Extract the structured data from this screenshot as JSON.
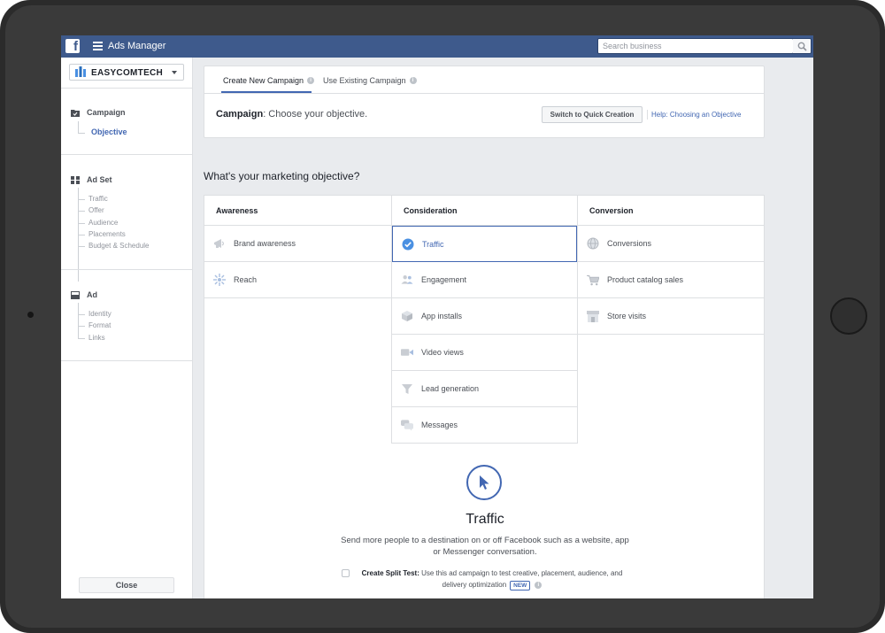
{
  "topbar": {
    "logo_letter": "f",
    "app_title": "Ads Manager",
    "search_placeholder": "Search business"
  },
  "sidebar": {
    "account_name": "EASYCOMTECH",
    "campaign": {
      "title": "Campaign",
      "active_item": "Objective"
    },
    "adset": {
      "title": "Ad Set",
      "items": [
        "Traffic",
        "Offer",
        "Audience",
        "Placements",
        "Budget & Schedule"
      ]
    },
    "ad": {
      "title": "Ad",
      "items": [
        "Identity",
        "Format",
        "Links"
      ]
    },
    "close_label": "Close"
  },
  "tabs": {
    "create_new": "Create New Campaign",
    "use_existing": "Use Existing Campaign",
    "info_glyph": "i"
  },
  "campaign_header": {
    "label": "Campaign",
    "text": ": Choose your objective.",
    "quick_button": "Switch to Quick Creation",
    "help_link": "Help: Choosing an Objective"
  },
  "question": "What's your marketing objective?",
  "objectives": {
    "awareness": {
      "title": "Awareness",
      "items": [
        "Brand awareness",
        "Reach"
      ]
    },
    "consideration": {
      "title": "Consideration",
      "items": [
        "Traffic",
        "Engagement",
        "App installs",
        "Video views",
        "Lead generation",
        "Messages"
      ]
    },
    "conversion": {
      "title": "Conversion",
      "items": [
        "Conversions",
        "Product catalog sales",
        "Store visits"
      ]
    }
  },
  "detail": {
    "title": "Traffic",
    "description": "Send more people to a destination on or off Facebook such as a website, app or Messenger conversation.",
    "split_label": "Create Split Test:",
    "split_text": " Use this ad campaign to test creative, placement, audience, and delivery optimization",
    "new_badge": "NEW",
    "info_glyph": "i"
  },
  "colors": {
    "brand_blue": "#4267b2",
    "topbar": "#3e5a8c",
    "border": "#dddfe2",
    "muted_text": "#90949c"
  }
}
